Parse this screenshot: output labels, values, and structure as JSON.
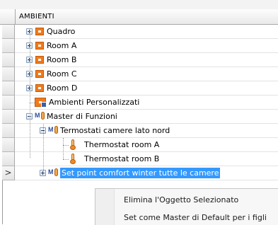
{
  "grid": {
    "header": "AMBIENTI",
    "rows": [
      {
        "label": "Quadro"
      },
      {
        "label": "Room A"
      },
      {
        "label": "Room B"
      },
      {
        "label": "Room C"
      },
      {
        "label": "Room D"
      },
      {
        "label": "Ambienti Personalizzati"
      },
      {
        "label": "Master di Funzioni"
      },
      {
        "label": "Termostati camere lato nord"
      },
      {
        "label": "Thermostat room A"
      },
      {
        "label": "Thermostat room B"
      },
      {
        "label": "Set point comfort winter tutte le camere",
        "row_selector": ">"
      }
    ]
  },
  "context_menu": {
    "items": [
      {
        "label": "Elimina l'Oggetto Selezionato"
      },
      {
        "label": "Set come Master di Default per i figli"
      }
    ]
  },
  "colors": {
    "selection": "#3399ff",
    "room_icon": "#f07a1b"
  }
}
